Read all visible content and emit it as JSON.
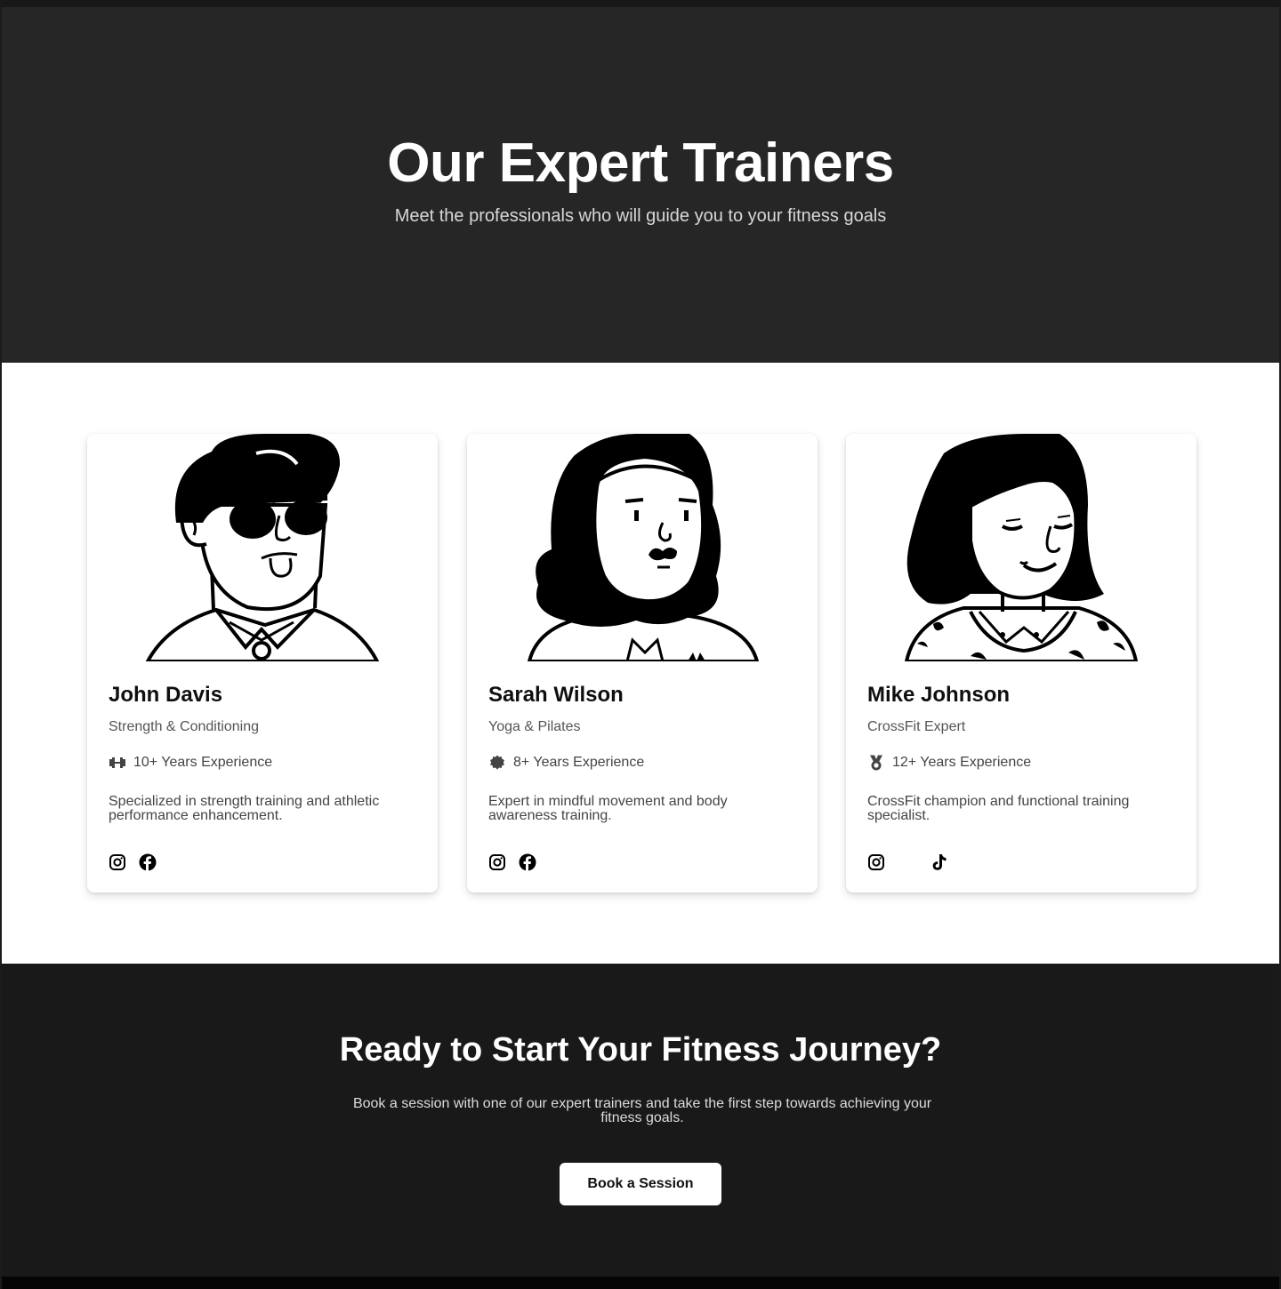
{
  "hero": {
    "title": "Our Expert Trainers",
    "subtitle": "Meet the professionals who will guide you to your fitness goals"
  },
  "trainers": [
    {
      "name": "John Davis",
      "specialty": "Strength & Conditioning",
      "experience_icon": "dumbbell-icon",
      "experience": "10+ Years Experience",
      "description": "Specialized in strength training and athletic performance enhancement.",
      "socials": [
        "instagram-icon",
        "facebook-icon"
      ]
    },
    {
      "name": "Sarah Wilson",
      "specialty": "Yoga & Pilates",
      "experience_icon": "badge-icon",
      "experience": "8+ Years Experience",
      "description": "Expert in mindful movement and body awareness training.",
      "socials": [
        "instagram-icon",
        "facebook-icon"
      ]
    },
    {
      "name": "Mike Johnson",
      "specialty": "CrossFit Expert",
      "experience_icon": "medal-icon",
      "experience": "12+ Years Experience",
      "description": "CrossFit champion and functional training specialist.",
      "socials": [
        "instagram-icon",
        "tiktok-icon"
      ]
    }
  ],
  "cta": {
    "title": "Ready to Start Your Fitness Journey?",
    "text": "Book a session with one of our expert trainers and take the first step towards achieving your fitness goals.",
    "button": "Book a Session"
  },
  "colors": {
    "hero_bg": "#262626",
    "cta_bg": "#191919",
    "card_bg": "#ffffff",
    "text_dark": "#0f0f0f",
    "text_muted": "#555555"
  }
}
